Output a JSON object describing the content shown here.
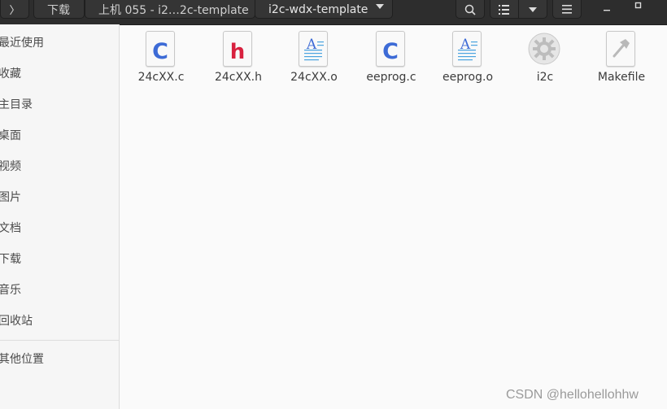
{
  "header": {
    "crumbs": [
      "下载",
      "上机 055 - i2…2c-template",
      "i2c-wdx-template"
    ],
    "icons": [
      "back-chevron-icon",
      "dropdown-arrow-icon",
      "search-icon",
      "list-view-icon",
      "view-options-icon",
      "menu-icon",
      "minimize-icon",
      "maximize-icon"
    ]
  },
  "sidebar": {
    "items": [
      {
        "label": "最近使用"
      },
      {
        "label": "收藏"
      },
      {
        "label": "主目录"
      },
      {
        "label": "桌面"
      },
      {
        "label": "视频"
      },
      {
        "label": "图片"
      },
      {
        "label": "文档"
      },
      {
        "label": "下载"
      },
      {
        "label": "音乐"
      },
      {
        "label": "回收站"
      },
      {
        "label": "其他位置"
      }
    ]
  },
  "files": [
    {
      "name": "24cXX.c",
      "type": "c-source"
    },
    {
      "name": "24cXX.h",
      "type": "c-header"
    },
    {
      "name": "24cXX.o",
      "type": "object"
    },
    {
      "name": "eeprog.c",
      "type": "c-source"
    },
    {
      "name": "eeprog.o",
      "type": "object"
    },
    {
      "name": "i2c",
      "type": "executable"
    },
    {
      "name": "Makefile",
      "type": "makefile"
    }
  ],
  "watermark": "CSDN @hellohellohhw",
  "colors": {
    "header": "#2d2d2d",
    "c_icon": "#3d6bd6",
    "h_icon": "#d8213f",
    "doc_lines": "#4aa3df"
  }
}
